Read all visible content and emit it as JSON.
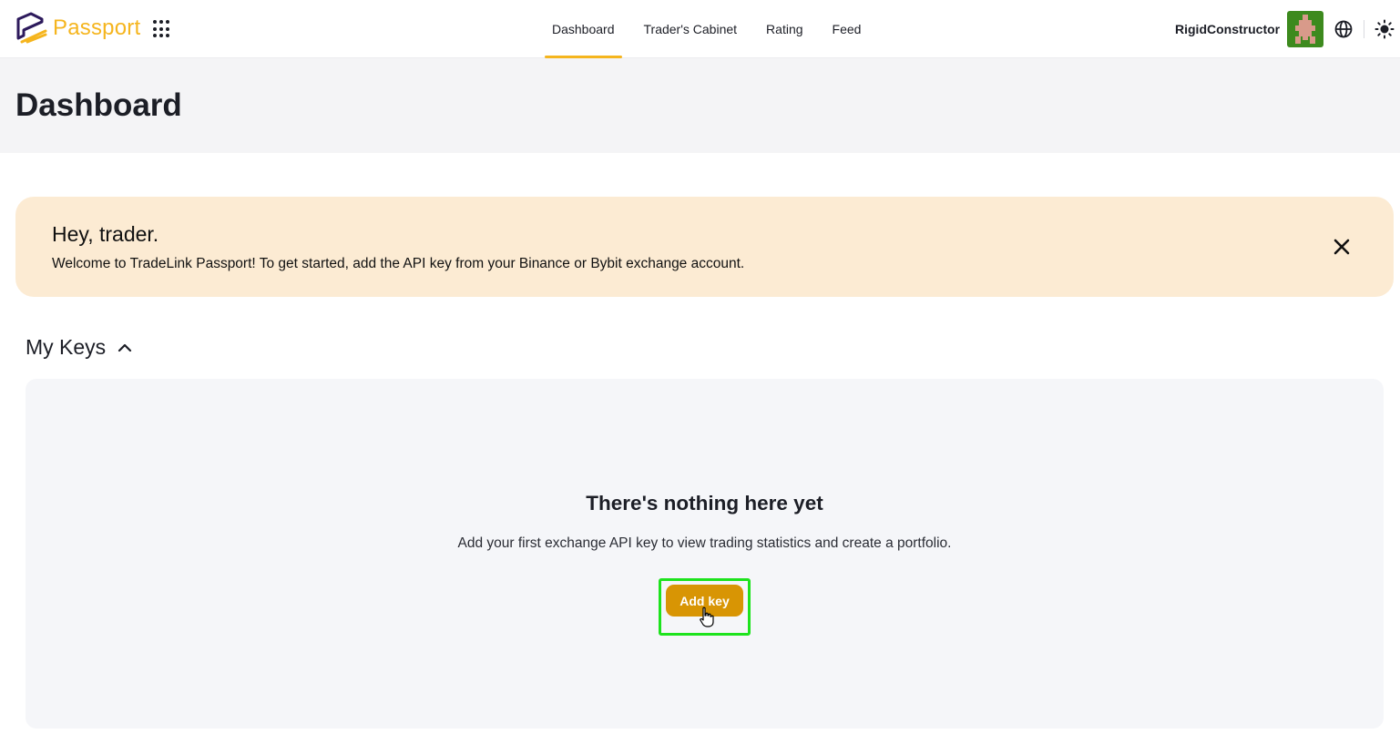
{
  "header": {
    "brand": "Passport",
    "nav": [
      {
        "label": "Dashboard",
        "active": true
      },
      {
        "label": "Trader's Cabinet",
        "active": false
      },
      {
        "label": "Rating",
        "active": false
      },
      {
        "label": "Feed",
        "active": false
      }
    ],
    "username": "RigidConstructor",
    "icons": [
      "apps-grid-icon",
      "globe-icon",
      "sun-icon"
    ]
  },
  "page": {
    "title": "Dashboard"
  },
  "banner": {
    "title": "Hey, trader.",
    "text": "Welcome to TradeLink Passport! To get started, add the API key from your Binance or Bybit exchange account."
  },
  "keys": {
    "title": "My Keys",
    "empty_title": "There's nothing here yet",
    "empty_text": "Add your first exchange API key to view trading statistics and create a portfolio.",
    "add_label": "Add key"
  },
  "colors": {
    "accent": "#f5b51e",
    "button": "#d89504",
    "banner_bg": "#fcebd3",
    "highlight": "#1de31d"
  }
}
